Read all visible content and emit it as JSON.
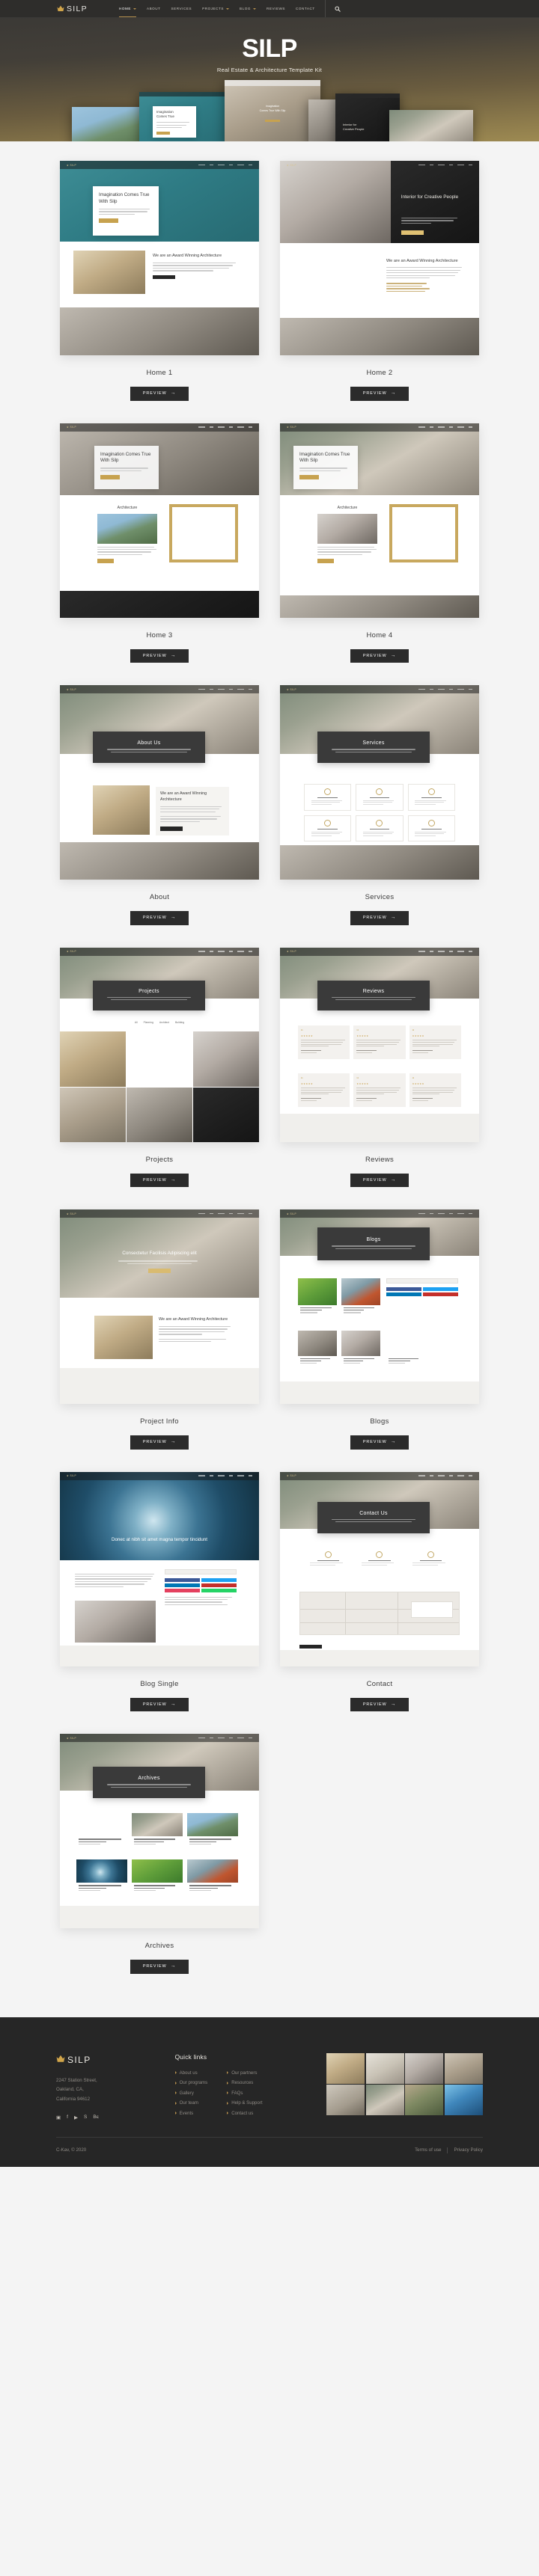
{
  "header": {
    "brand": "SILP",
    "brand_icon": "crown-icon",
    "nav": [
      {
        "label": "HOME",
        "has_caret": true,
        "active": true
      },
      {
        "label": "ABOUT",
        "has_caret": false,
        "active": false
      },
      {
        "label": "SERVICES",
        "has_caret": false,
        "active": false
      },
      {
        "label": "PROJECTS",
        "has_caret": true,
        "active": false
      },
      {
        "label": "BLOG",
        "has_caret": true,
        "active": false
      },
      {
        "label": "REVIEWS",
        "has_caret": false,
        "active": false
      },
      {
        "label": "CONTACT",
        "has_caret": false,
        "active": false
      }
    ],
    "search_icon": "search-icon"
  },
  "hero": {
    "title": "SILP",
    "subtitle": "Real Estate & Architecture Template Kit"
  },
  "kit": {
    "preview_label": "PREVIEW",
    "preview_arrow": "→",
    "cards": [
      {
        "label": "Home 1",
        "kind": "home1"
      },
      {
        "label": "Home 2",
        "kind": "home2"
      },
      {
        "label": "Home 3",
        "kind": "home3"
      },
      {
        "label": "Home 4",
        "kind": "home4"
      },
      {
        "label": "About",
        "kind": "about"
      },
      {
        "label": "Services",
        "kind": "services"
      },
      {
        "label": "Projects",
        "kind": "projects"
      },
      {
        "label": "Reviews",
        "kind": "reviews"
      },
      {
        "label": "Project Info",
        "kind": "projectinfo"
      },
      {
        "label": "Blogs",
        "kind": "blogs"
      },
      {
        "label": "Blog Single",
        "kind": "blogsingle"
      },
      {
        "label": "Contact",
        "kind": "contact"
      },
      {
        "label": "Archives",
        "kind": "archives"
      }
    ],
    "mock_text": {
      "home1_heading": "Imagination Comes True With Silp",
      "home2_heading": "Interior for Creative People",
      "home2_sub_heading": "We are an Award Winning Architecture",
      "home3_section": "Architecture",
      "about_title": "About Us",
      "services_title": "Services",
      "projects_title": "Projects",
      "reviews_title": "Reviews",
      "projectinfo_heading": "Consectetur Facilisis Adipiscing elit",
      "blogs_title": "Blogs",
      "blogsingle_heading": "Donec at nibh sit amet magna tempor tincidunt",
      "contact_title": "Contact Us",
      "archives_title": "Archives",
      "about_sub_heading": "We are an Award Winning Architecture"
    }
  },
  "footer": {
    "brand": "SILP",
    "brand_icon": "crown-icon",
    "address": "2247  Station Street,\nOakland, CA,\nCalifornia 94612",
    "socials": [
      {
        "name": "instagram-icon",
        "glyph": "▣"
      },
      {
        "name": "facebook-icon",
        "glyph": "f"
      },
      {
        "name": "youtube-icon",
        "glyph": "▶"
      },
      {
        "name": "skype-icon",
        "glyph": "S"
      },
      {
        "name": "behance-icon",
        "glyph": "Bє"
      }
    ],
    "quick_links_heading": "Quick links",
    "links_col1": [
      "About us",
      "Our programs",
      "Gallery",
      "Our team",
      "Events"
    ],
    "links_col2": [
      "Our partners",
      "Resources",
      "FAQs",
      "Help & Support",
      "Contact us"
    ],
    "copyright": "C-Kav, © 2020",
    "terms": "Terms of use",
    "privacy": "Privacy Policy"
  },
  "colors": {
    "accent": "#b8924f",
    "gold": "#c7a24f",
    "dark": "#262626",
    "page_bg": "#f4f4f4"
  }
}
